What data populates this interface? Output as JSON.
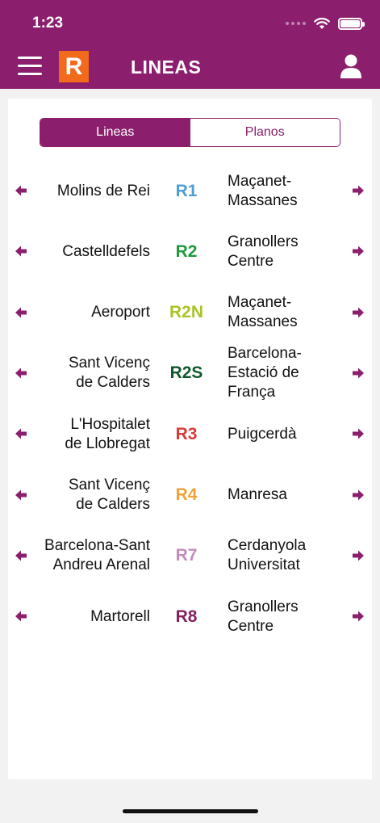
{
  "status_bar": {
    "time": "1:23"
  },
  "header": {
    "logo_letter": "R",
    "title": "LINEAS"
  },
  "tabs": [
    {
      "label": "Lineas",
      "active": true
    },
    {
      "label": "Planos",
      "active": false
    }
  ],
  "colors": {
    "brand": "#8c1f6d",
    "logo": "#f26a1b"
  },
  "lines": [
    {
      "origin": "Molins de Rei",
      "code": "R1",
      "color": "#4e9fd1",
      "destination": "Maçanet-\nMassanes"
    },
    {
      "origin": "Castelldefels",
      "code": "R2",
      "color": "#1e9a3e",
      "destination": "Granollers\nCentre"
    },
    {
      "origin": "Aeroport",
      "code": "R2N",
      "color": "#a8c326",
      "destination": "Maçanet-\nMassanes"
    },
    {
      "origin": "Sant Vicenç\nde Calders",
      "code": "R2S",
      "color": "#0e5a2c",
      "destination": "Barcelona-\nEstació de\nFrança"
    },
    {
      "origin": "L'Hospitalet\nde Llobregat",
      "code": "R3",
      "color": "#d93a36",
      "destination": "Puigcerdà"
    },
    {
      "origin": "Sant Vicenç\nde Calders",
      "code": "R4",
      "color": "#f0a13a",
      "destination": "Manresa"
    },
    {
      "origin": "Barcelona-Sant\nAndreu Arenal",
      "code": "R7",
      "color": "#c58cbb",
      "destination": "Cerdanyola\nUniversitat"
    },
    {
      "origin": "Martorell",
      "code": "R8",
      "color": "#87205f",
      "destination": "Granollers\nCentre"
    }
  ]
}
